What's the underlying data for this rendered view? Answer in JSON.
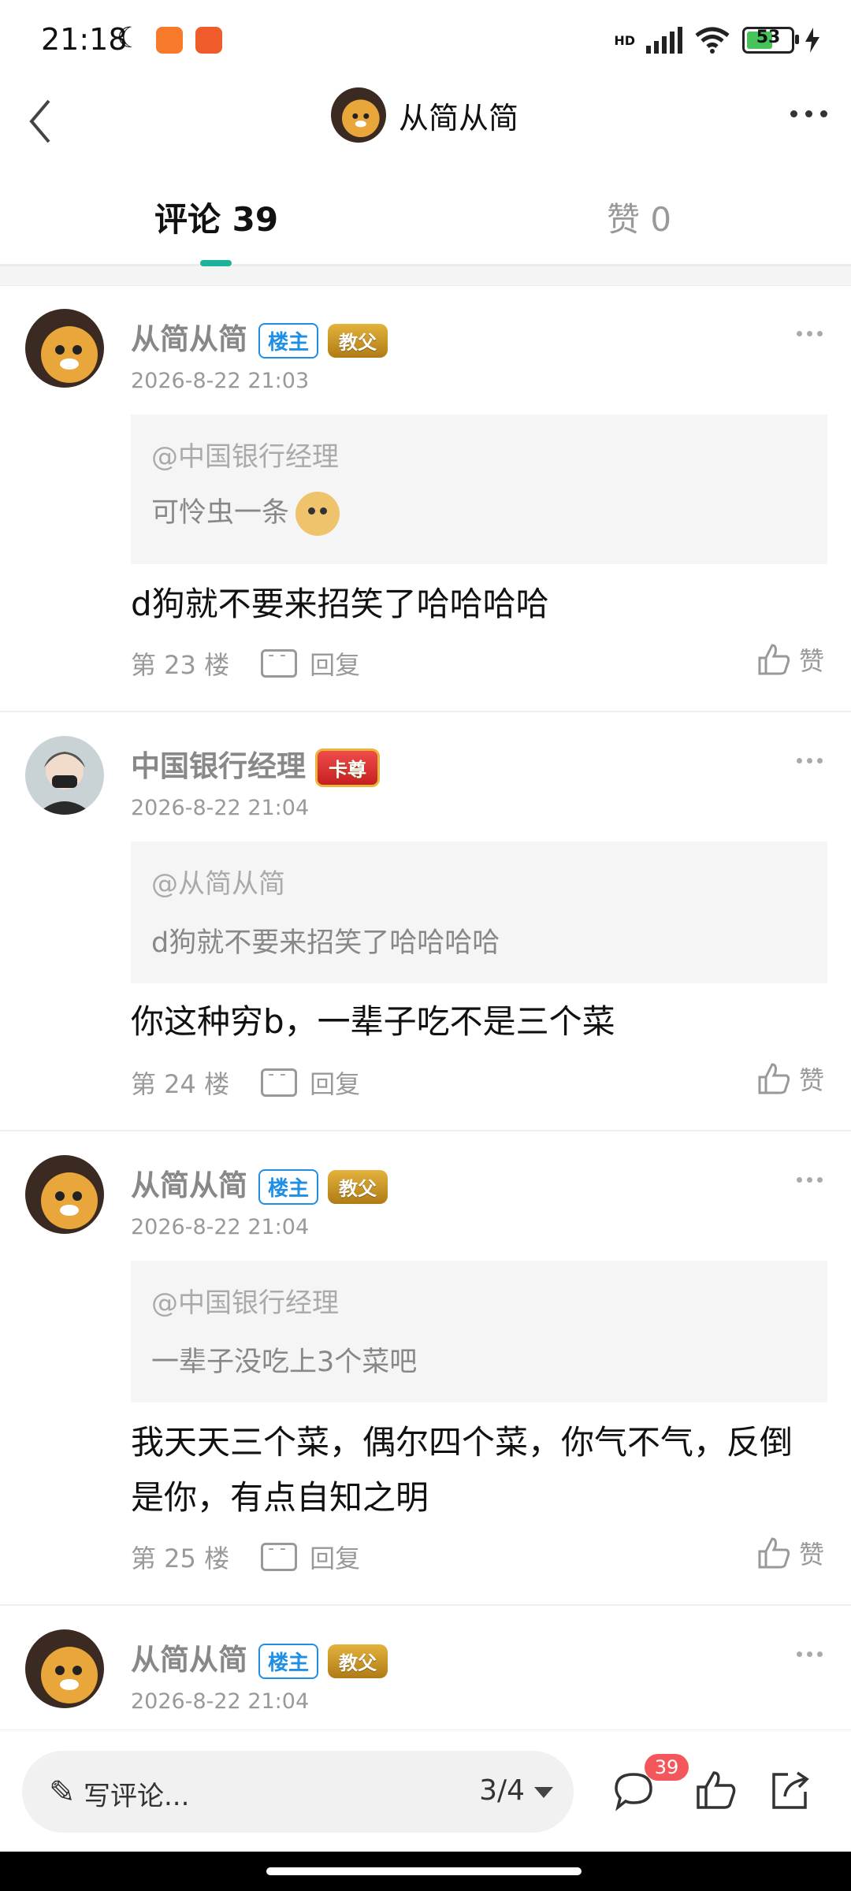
{
  "status_bar": {
    "time": "21:18",
    "battery": "53",
    "network": "HD"
  },
  "header": {
    "title": "从简从简"
  },
  "tabs": [
    {
      "label": "评论 39",
      "active": true
    },
    {
      "label": "赞 0",
      "active": false
    }
  ],
  "comments": [
    {
      "user": "从简从简",
      "owner_badge": "楼主",
      "medal": "教父",
      "time": "2026-8-22 21:03",
      "quote_user": "@中国银行经理",
      "quote_text": "可怜虫一条",
      "text": "d狗就不要来招笑了哈哈哈哈",
      "floor": "第 23 楼",
      "reply": "回复",
      "like": "赞"
    },
    {
      "user": "中国银行经理",
      "medal": "卡尊",
      "time": "2026-8-22 21:04",
      "quote_user": "@从简从简",
      "quote_text": "d狗就不要来招笑了哈哈哈哈",
      "text": "你这种穷b，一辈子吃不是三个菜",
      "floor": "第 24 楼",
      "reply": "回复",
      "like": "赞"
    },
    {
      "user": "从简从简",
      "owner_badge": "楼主",
      "medal": "教父",
      "time": "2026-8-22 21:04",
      "quote_user": "@中国银行经理",
      "quote_text": "一辈子没吃上3个菜吧",
      "text_line1": "我天天三个菜，偶尔四个菜，你气不气，反倒",
      "text_line2": "是你，有点自知之明",
      "floor": "第 25 楼",
      "reply": "回复",
      "like": "赞"
    },
    {
      "user": "从简从简",
      "owner_badge": "楼主",
      "medal": "教父",
      "time": "2026-8-22 21:04"
    }
  ],
  "bottom_bar": {
    "placeholder": "写评论...",
    "page": "3/4",
    "comment_count": "39"
  }
}
